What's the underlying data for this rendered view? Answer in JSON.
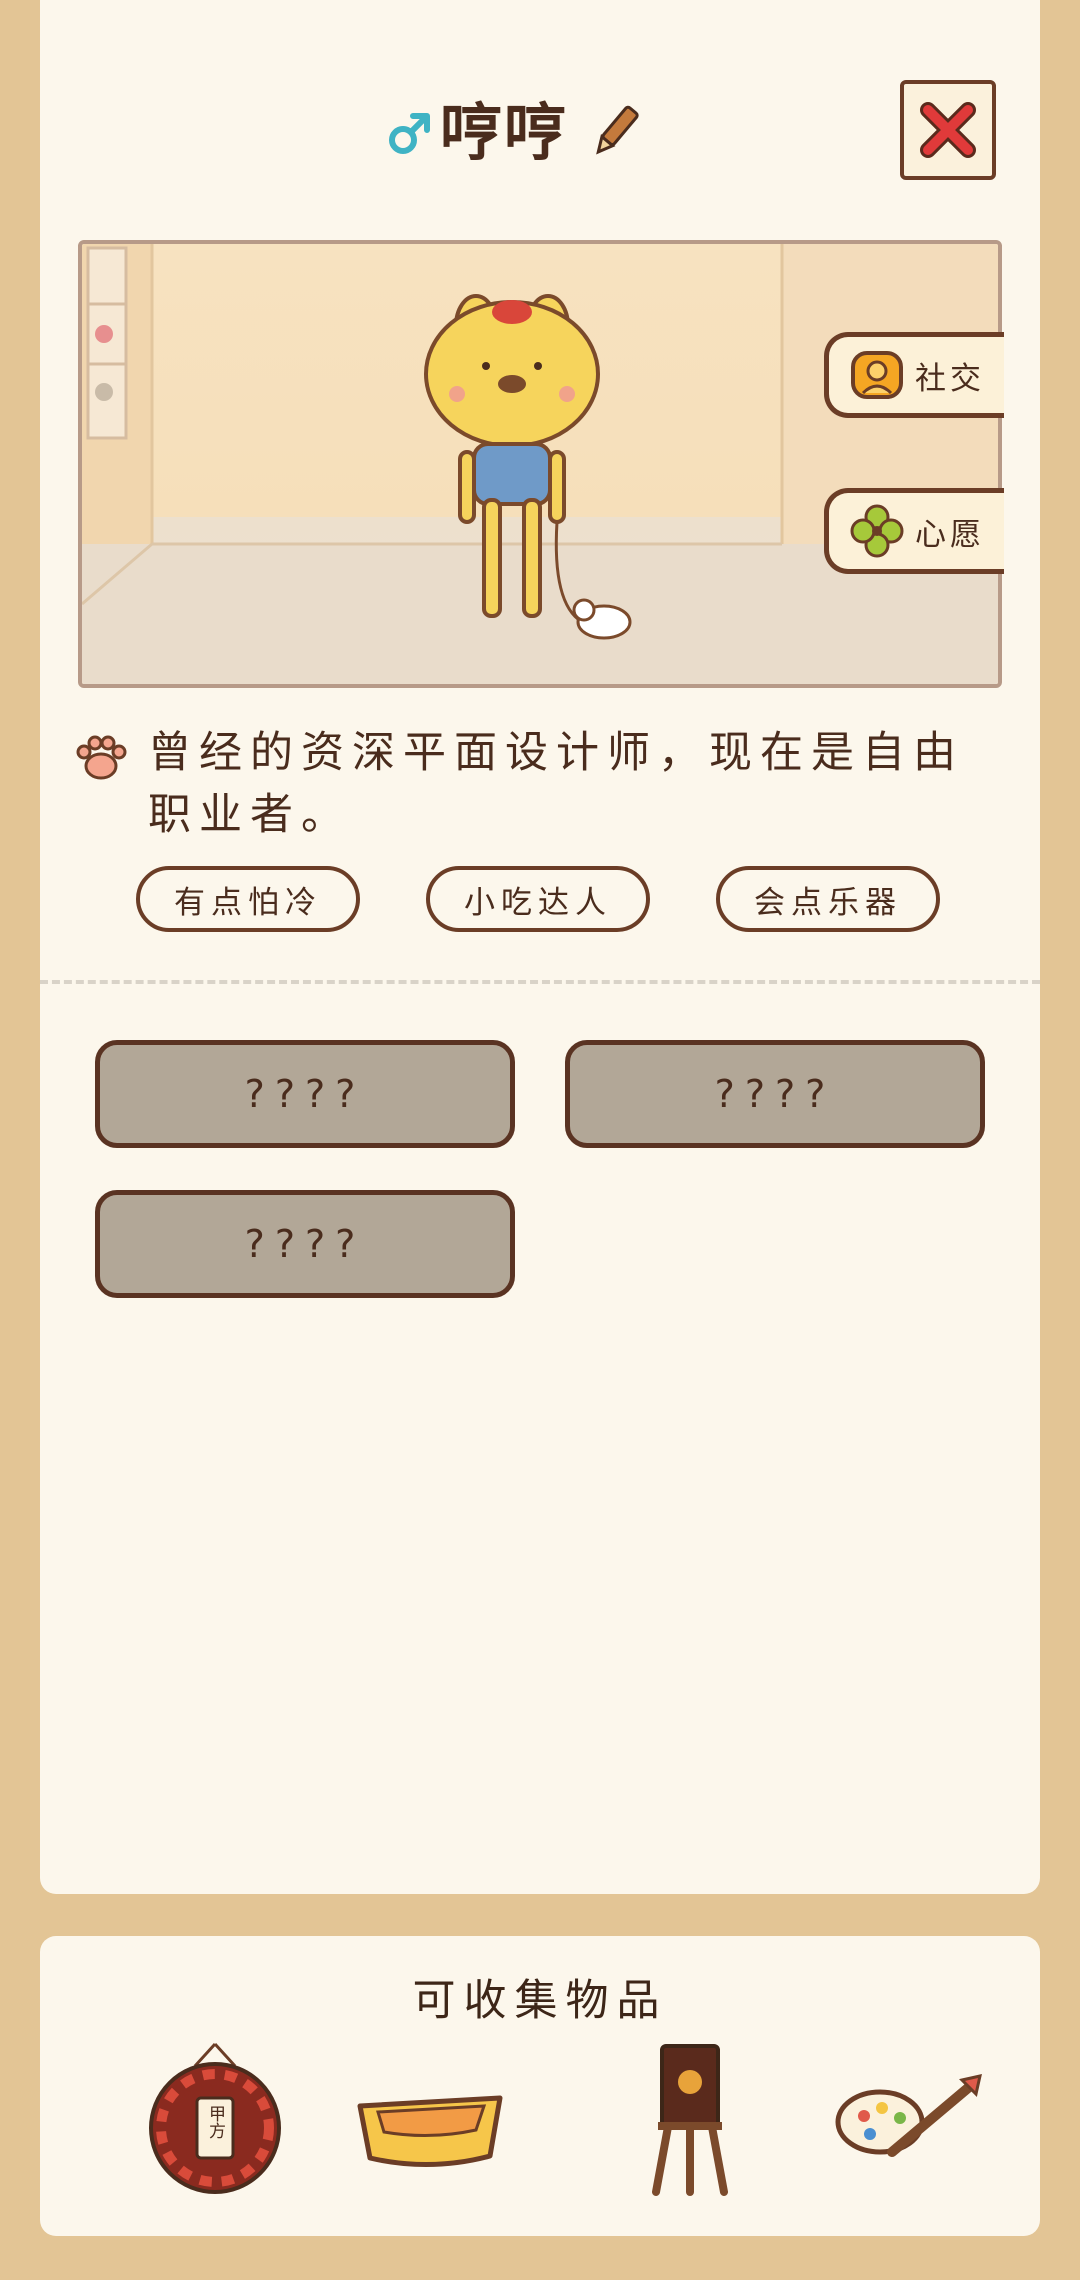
{
  "header": {
    "name": "哼哼",
    "gender_icon": "male-icon",
    "edit_icon": "pencil-icon",
    "close_icon": "close-x-icon"
  },
  "scene": {
    "side_buttons": [
      {
        "label": "社交",
        "icon": "social-icon"
      },
      {
        "label": "心愿",
        "icon": "clover-icon"
      }
    ]
  },
  "profile": {
    "description": "曾经的资深平面设计师，现在是自由职业者。",
    "tags": [
      "有点怕冷",
      "小吃达人",
      "会点乐器"
    ]
  },
  "locked_slots": [
    "????",
    "????",
    "????"
  ],
  "collectibles": {
    "title": "可收集物品",
    "sign_text": "甲方",
    "items": [
      {
        "icon": "dartboard-icon"
      },
      {
        "icon": "pet-bed-icon"
      },
      {
        "icon": "easel-icon"
      },
      {
        "icon": "palette-brush-icon"
      }
    ]
  },
  "colors": {
    "background": "#e3c595",
    "card": "#fcf7ec",
    "outline": "#6b3d26",
    "text": "#4a2c1d",
    "locked_fill": "#b2a797",
    "close_x": "#e03a3a"
  }
}
